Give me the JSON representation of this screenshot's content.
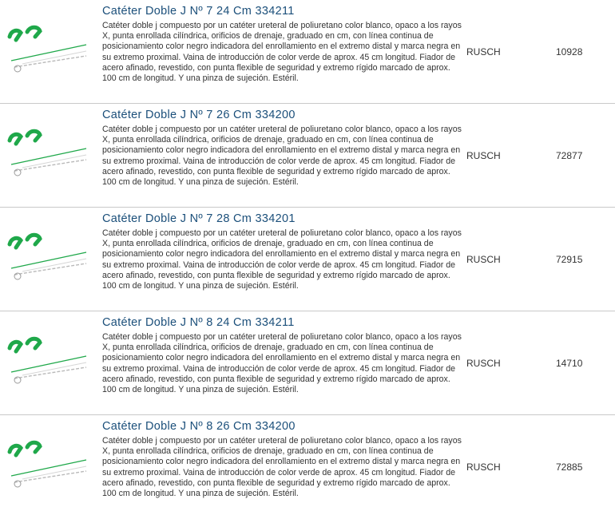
{
  "products": [
    {
      "title": "Catéter Doble J Nº 7 24 Cm 334211",
      "description": "Catéter doble j compuesto por un catéter ureteral de poliuretano color blanco, opaco a los rayos X, punta enrollada cilíndrica, orificios de drenaje, graduado en cm, con línea continua de posicionamiento color negro indicadora del enrollamiento en el extremo distal y marca negra en su extremo proximal. Vaina de introducción de color verde de aprox. 45 cm longitud. Fiador de acero afinado, revestido, con punta flexible de seguridad y extremo rígido marcado de aprox. 100 cm de longitud. Y una pinza de sujeción. Estéril.",
      "brand": "RUSCH",
      "code": "10928"
    },
    {
      "title": "Catéter Doble J Nº 7 26 Cm 334200",
      "description": "Catéter doble j compuesto por un catéter ureteral de poliuretano color blanco, opaco a los rayos X, punta enrollada cilíndrica, orificios de drenaje, graduado en cm, con línea continua de posicionamiento color negro indicadora del enrollamiento en el extremo distal y marca negra en su extremo proximal. Vaina de introducción de color verde de aprox. 45 cm longitud. Fiador de acero afinado, revestido, con punta flexible de seguridad y extremo rígido marcado de aprox. 100 cm de longitud. Y una pinza de sujeción. Estéril.",
      "brand": "RUSCH",
      "code": "72877"
    },
    {
      "title": "Catéter Doble J Nº 7 28 Cm 334201",
      "description": "Catéter doble j compuesto por un catéter ureteral de poliuretano color blanco, opaco a los rayos X, punta enrollada cilíndrica, orificios de drenaje, graduado en cm, con línea continua de posicionamiento color negro indicadora del enrollamiento en el extremo distal y marca negra en su extremo proximal. Vaina de introducción de color verde de aprox. 45 cm longitud. Fiador de acero afinado, revestido, con punta flexible de seguridad y extremo rígido marcado de aprox. 100 cm de longitud. Y una pinza de sujeción. Estéril.",
      "brand": "RUSCH",
      "code": "72915"
    },
    {
      "title": "Catéter Doble J Nº 8 24 Cm 334211",
      "description": "Catéter doble j compuesto por un catéter ureteral de poliuretano color blanco, opaco a los rayos X, punta enrollada cilíndrica, orificios de drenaje, graduado en cm, con línea continua de posicionamiento color negro indicadora del enrollamiento en el extremo distal y marca negra en su extremo proximal. Vaina de introducción de color verde de aprox. 45 cm longitud. Fiador de acero afinado, revestido, con punta flexible de seguridad y extremo rígido marcado de aprox. 100 cm de longitud. Y una pinza de sujeción. Estéril.",
      "brand": "RUSCH",
      "code": "14710"
    },
    {
      "title": "Catéter Doble J Nº 8 26 Cm 334200",
      "description": "Catéter doble j compuesto por un catéter ureteral de poliuretano color blanco, opaco a los rayos X, punta enrollada cilíndrica, orificios de drenaje, graduado en cm, con línea continua de posicionamiento color negro indicadora del enrollamiento en el extremo distal y marca negra en su extremo proximal. Vaina de introducción de color verde de aprox. 45 cm longitud. Fiador de acero afinado, revestido, con punta flexible de seguridad y extremo rígido marcado de aprox. 100 cm de longitud. Y una pinza de sujeción. Estéril.",
      "brand": "RUSCH",
      "code": "72885"
    }
  ],
  "colors": {
    "title": "#1b4f7a",
    "text": "#333333",
    "separator": "#c9c9c9",
    "catheter_green": "#1fa84a"
  },
  "icons": {
    "product_image": "double-j-catheter-image"
  }
}
